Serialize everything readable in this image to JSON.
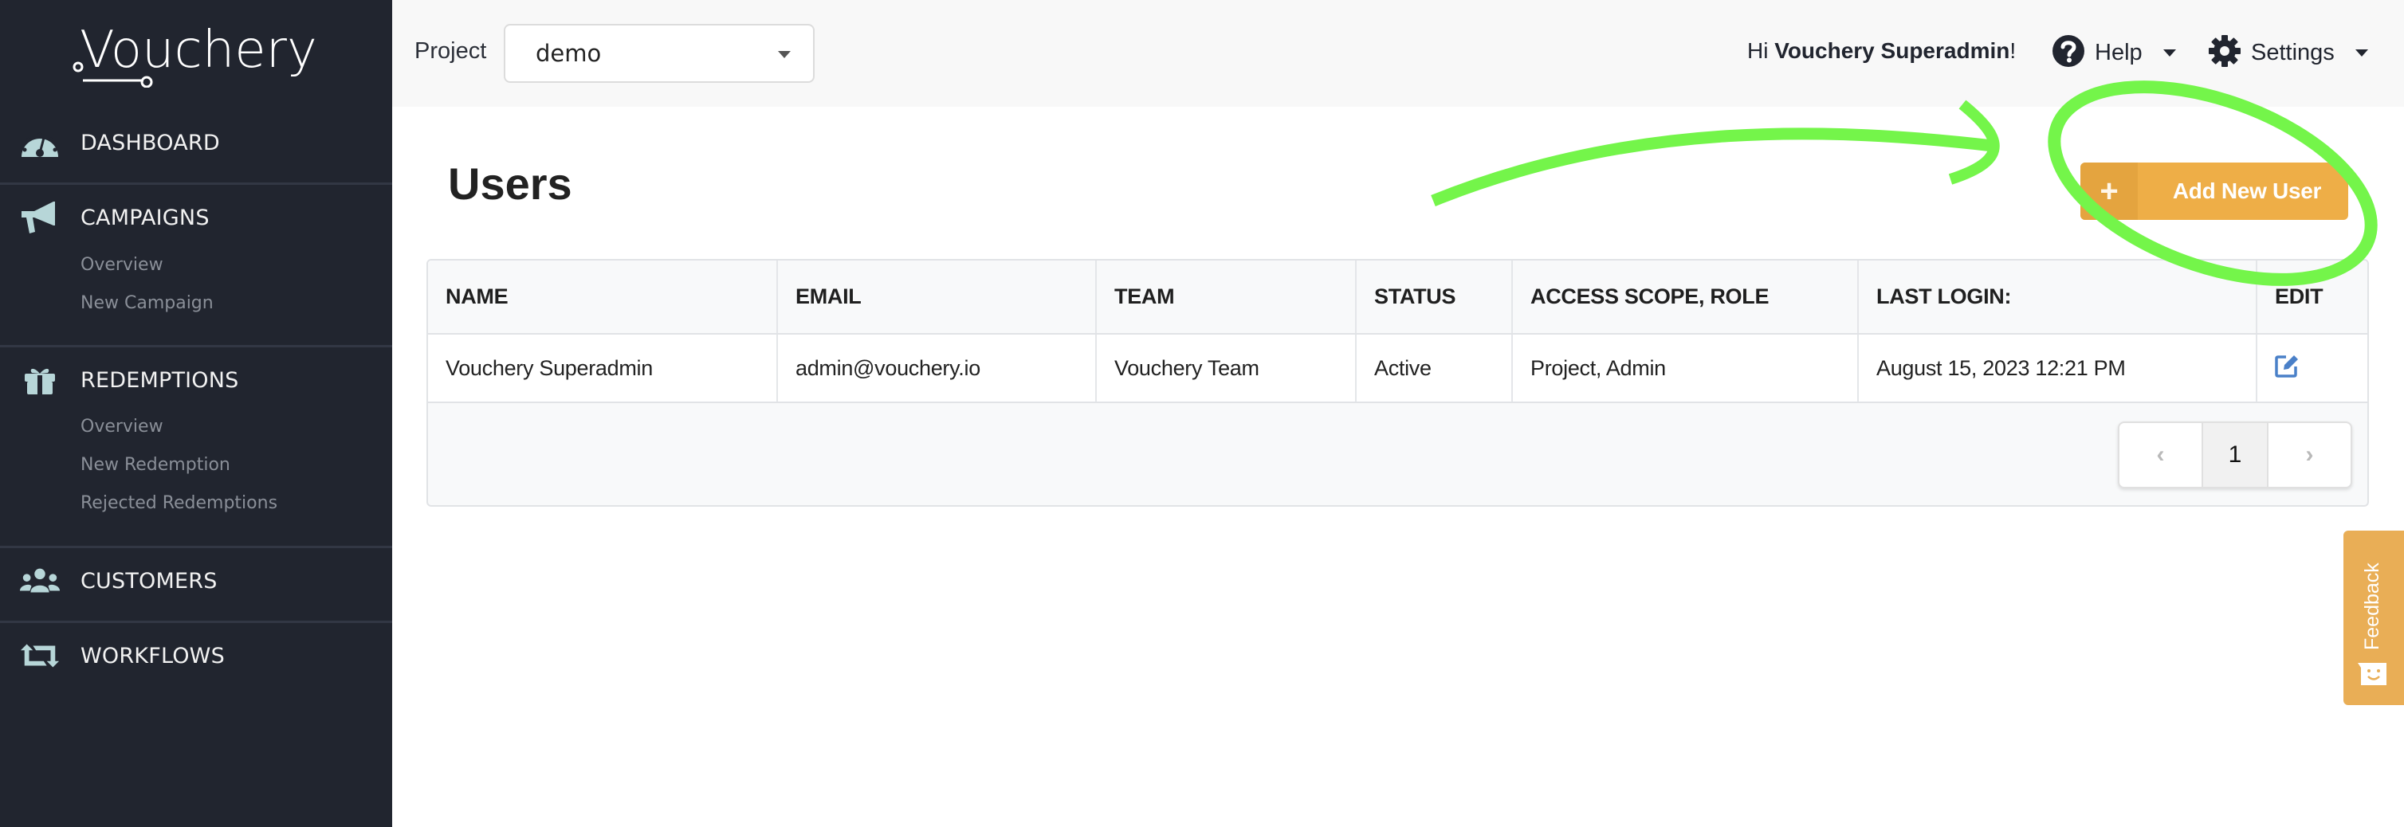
{
  "app": {
    "logo_text": "Vouchery"
  },
  "sidebar": {
    "items": [
      {
        "label": "DASHBOARD",
        "icon": "dashboard-gauge-icon"
      },
      {
        "label": "CAMPAIGNS",
        "icon": "megaphone-icon",
        "sub": [
          "Overview",
          "New Campaign"
        ]
      },
      {
        "label": "REDEMPTIONS",
        "icon": "gift-icon",
        "sub": [
          "Overview",
          "New Redemption",
          "Rejected Redemptions"
        ]
      },
      {
        "label": "CUSTOMERS",
        "icon": "users-icon"
      },
      {
        "label": "WORKFLOWS",
        "icon": "retweet-icon"
      }
    ]
  },
  "header": {
    "project_label": "Project",
    "project_value": "demo",
    "greeting_prefix": "Hi ",
    "greeting_name": "Vouchery Superadmin",
    "greeting_suffix": "!",
    "help_label": "Help",
    "settings_label": "Settings"
  },
  "main": {
    "title": "Users",
    "add_button_icon": "+",
    "add_button_label": "Add New User",
    "table": {
      "columns": [
        "NAME",
        "EMAIL",
        "TEAM",
        "STATUS",
        "ACCESS SCOPE, ROLE",
        "LAST LOGIN:",
        "EDIT"
      ],
      "rows": [
        {
          "name": "Vouchery Superadmin",
          "email": "admin@vouchery.io",
          "team": "Vouchery Team",
          "status": "Active",
          "access": "Project, Admin",
          "last_login": "August 15, 2023 12:21 PM",
          "edit_icon": "edit-icon"
        }
      ]
    },
    "pagination": {
      "prev": "‹",
      "current": "1",
      "next": "›"
    }
  },
  "feedback": {
    "label": "Feedback"
  },
  "colors": {
    "sidebar_bg": "#21252f",
    "sidebar_icon": "#b7d6d8",
    "accent_orange": "#eeae47",
    "edit_blue": "#4a80c8",
    "annotation_green": "#74f54a"
  }
}
